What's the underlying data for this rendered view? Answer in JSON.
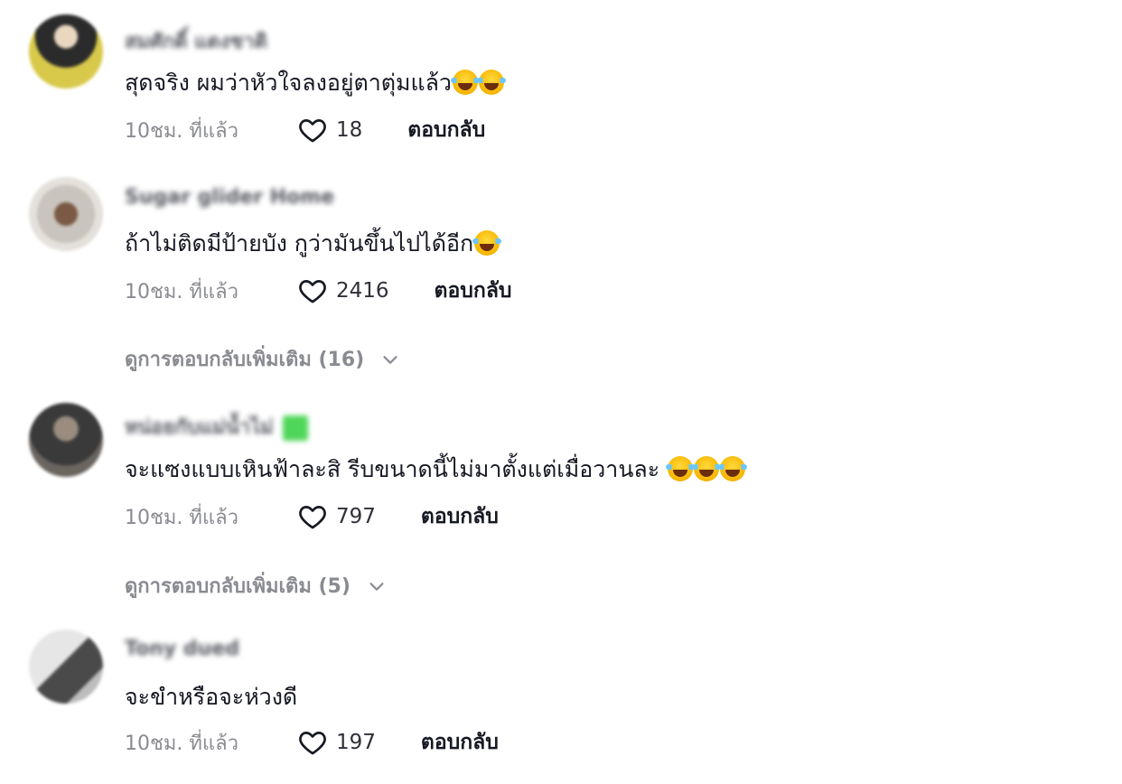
{
  "comments": [
    {
      "username": "สมศักดิ์ แดงชาติ",
      "verified": false,
      "text": "สุดจริง ผมว่าหัวใจลงอยู่ตาตุ่มแล้ว",
      "emoji_count": 2,
      "time": "10ชม. ที่แล้ว",
      "likes": "18",
      "reply_label": "ตอบกลับ",
      "avatar_colors": [
        "#2b2b2b",
        "#d8c94a"
      ]
    },
    {
      "username": "Sugar glider Home",
      "verified": false,
      "text": "ถ้าไม่ติดมีป้ายบัง กูว่ามันขึ้นไปได้อีก",
      "emoji_count": 1,
      "time": "10ชม. ที่แล้ว",
      "likes": "2416",
      "reply_label": "ตอบกลับ",
      "more_replies": "ดูการตอบกลับเพิ่มเติม (16)",
      "avatar_colors": [
        "#c9c4bd",
        "#7a5a45"
      ]
    },
    {
      "username": "หน่อยกับแม่น้ำไม่",
      "verified": true,
      "text": "จะแซงแบบเหินฟ้าละสิ รีบขนาดนี้ไม่มาตั้งแต่เมื่อวานละ ",
      "emoji_count": 3,
      "time": "10ชม. ที่แล้ว",
      "likes": "797",
      "reply_label": "ตอบกลับ",
      "more_replies": "ดูการตอบกลับเพิ่มเติม (5)",
      "avatar_colors": [
        "#3a3a3a",
        "#9a8d80"
      ]
    },
    {
      "username": "Tony dued",
      "verified": false,
      "text": "จะขำหรือจะห่วงดี",
      "emoji_count": 0,
      "time": "10ชม. ที่แล้ว",
      "likes": "197",
      "reply_label": "ตอบกลับ",
      "avatar_colors": [
        "#d9d9d9",
        "#4a4a4a"
      ]
    }
  ],
  "icons": {
    "like": "heart-outline-icon",
    "expand": "chevron-down-icon"
  },
  "colors": {
    "primary_text": "#161823",
    "secondary_text": "#8a8b91",
    "verified_badge": "#2fcf3b"
  }
}
